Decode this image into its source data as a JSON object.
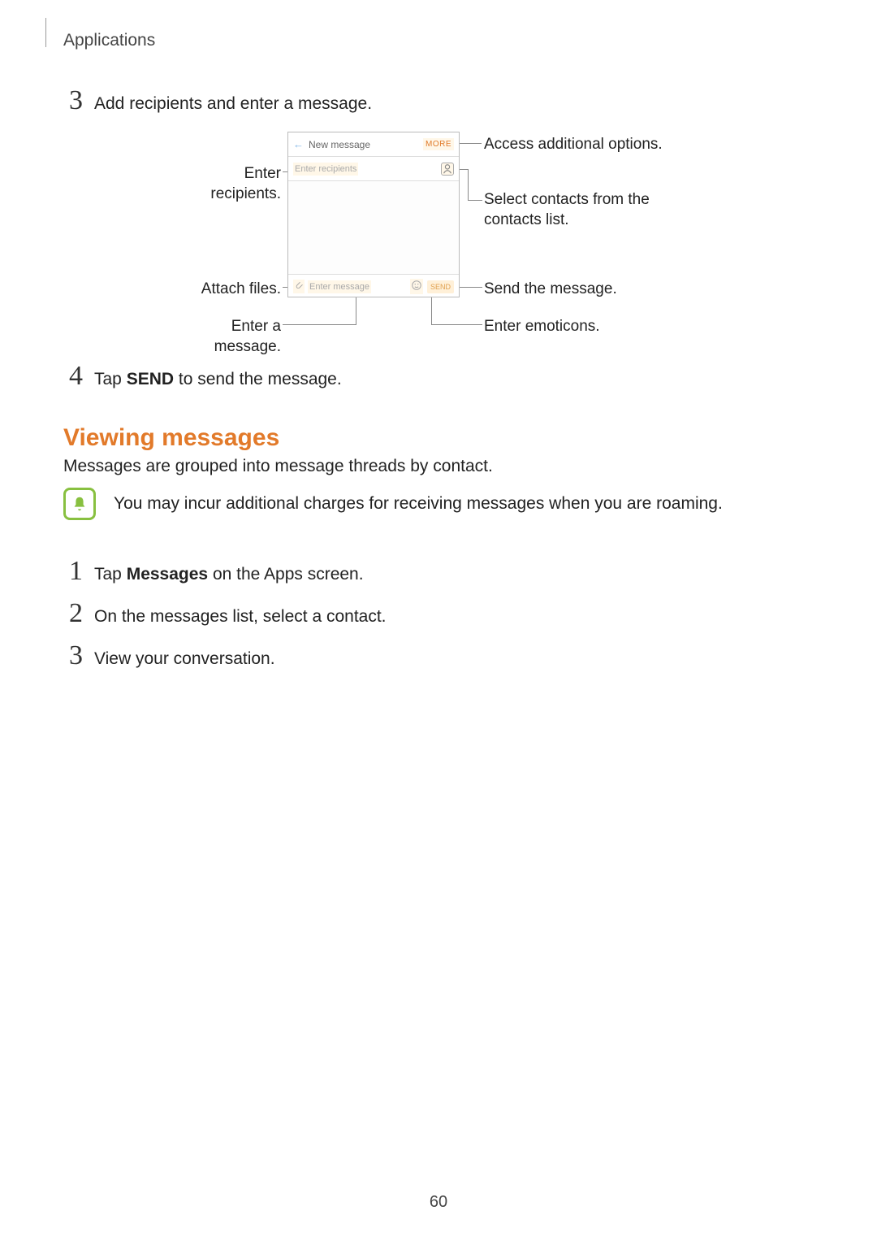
{
  "header": {
    "section": "Applications"
  },
  "steps_top": {
    "s3": {
      "num": "3",
      "text": "Add recipients and enter a message."
    },
    "s4": {
      "num": "4",
      "prefix": "Tap ",
      "bold": "SEND",
      "suffix": " to send the message."
    }
  },
  "heading2": "Viewing messages",
  "paragraph": "Messages are grouped into message threads by contact.",
  "notice": "You may incur additional charges for receiving messages when you are roaming.",
  "steps_view": {
    "v1": {
      "num": "1",
      "prefix": "Tap ",
      "bold": "Messages",
      "suffix": " on the Apps screen."
    },
    "v2": {
      "num": "2",
      "text": "On the messages list, select a contact."
    },
    "v3": {
      "num": "3",
      "text": "View your conversation."
    }
  },
  "diagram": {
    "phone": {
      "title": "New message",
      "more": "MORE",
      "recipients_placeholder": "Enter recipients",
      "enter_message": "Enter message",
      "send": "SEND"
    },
    "callouts": {
      "enter_recipients": "Enter recipients.",
      "attach_files": "Attach files.",
      "enter_a_message": "Enter a message.",
      "access_options": "Access additional options.",
      "select_contacts": "Select contacts from the contacts list.",
      "send_message": "Send the message.",
      "enter_emoticons": "Enter emoticons."
    }
  },
  "page_number": "60"
}
